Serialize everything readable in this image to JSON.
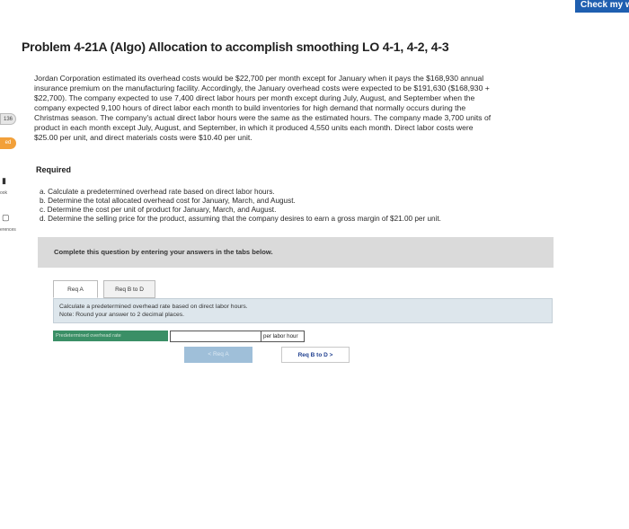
{
  "header": {
    "check_button": "Check my w"
  },
  "left_strip": {
    "badge_gray": "136",
    "badge_orange": "ed",
    "book_label": "ook",
    "references_label": "erences"
  },
  "problem": {
    "title": "Problem 4-21A (Algo) Allocation to accomplish smoothing LO 4-1, 4-2, 4-3",
    "lines": [
      "Jordan Corporation estimated its overhead costs would be $22,700 per month except for January when it pays the $168,930 annual",
      "insurance premium on the manufacturing facility. Accordingly, the January overhead costs were expected to be $191,630 ($168,930 +",
      "$22,700). The company expected to use 7,400 direct labor hours per month except during July, August, and September when the",
      "company expected 9,100 hours of direct labor each month to build inventories for high demand that normally occurs during the",
      "Christmas season. The company's actual direct labor hours were the same as the estimated hours. The company made 3,700 units of",
      "product in each month except July, August, and September, in which it produced 4,550 units each month. Direct labor costs were",
      "$25.00 per unit, and direct materials costs were $10.40 per unit."
    ]
  },
  "required": {
    "heading": "Required",
    "items": [
      "a. Calculate a predetermined overhead rate based on direct labor hours.",
      "b. Determine the total allocated overhead cost for January, March, and August.",
      "c. Determine the cost per unit of product for January, March, and August.",
      "d. Determine the selling price for the product, assuming that the company desires to earn a gross margin of $21.00 per unit."
    ]
  },
  "banner": {
    "text": "Complete this question by entering your answers in the tabs below."
  },
  "tabs": [
    {
      "label": "Req A"
    },
    {
      "label": "Req B to D"
    }
  ],
  "instruction": {
    "line1": "Calculate a predetermined overhead rate based on direct labor hours.",
    "line2": "Note: Round your answer to 2 decimal places."
  },
  "answer": {
    "label": "Predetermined overhead rate",
    "value": "",
    "unit": "per labor hour"
  },
  "nav": {
    "prev": "< Req A",
    "next": "Req B to D  >"
  },
  "colors": {
    "accent_blue": "#1f5fb0",
    "answer_label_green": "#3a8f66",
    "instruction_bg": "#dde6ec",
    "badge_orange": "#f2a03a"
  }
}
